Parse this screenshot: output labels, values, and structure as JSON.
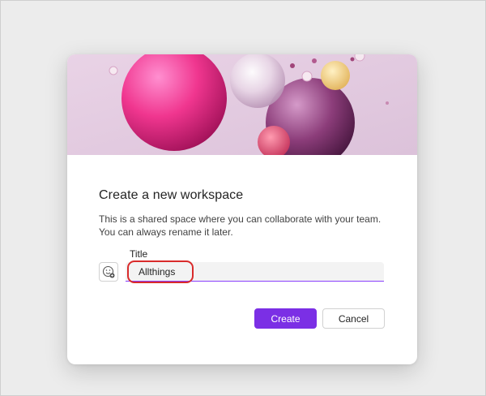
{
  "dialog": {
    "title": "Create a new workspace",
    "description_line1": "This is a shared space where you can collaborate with your team.",
    "description_line2": "You can always rename it later.",
    "title_field": {
      "label": "Title",
      "value": "Allthings"
    },
    "icon_picker": {
      "icon": "emoji-icon"
    },
    "create_label": "Create",
    "cancel_label": "Cancel"
  },
  "colors": {
    "accent": "#7b2fe5",
    "highlight_outline": "#d92b2b",
    "hero_background": "#e4cde0"
  }
}
